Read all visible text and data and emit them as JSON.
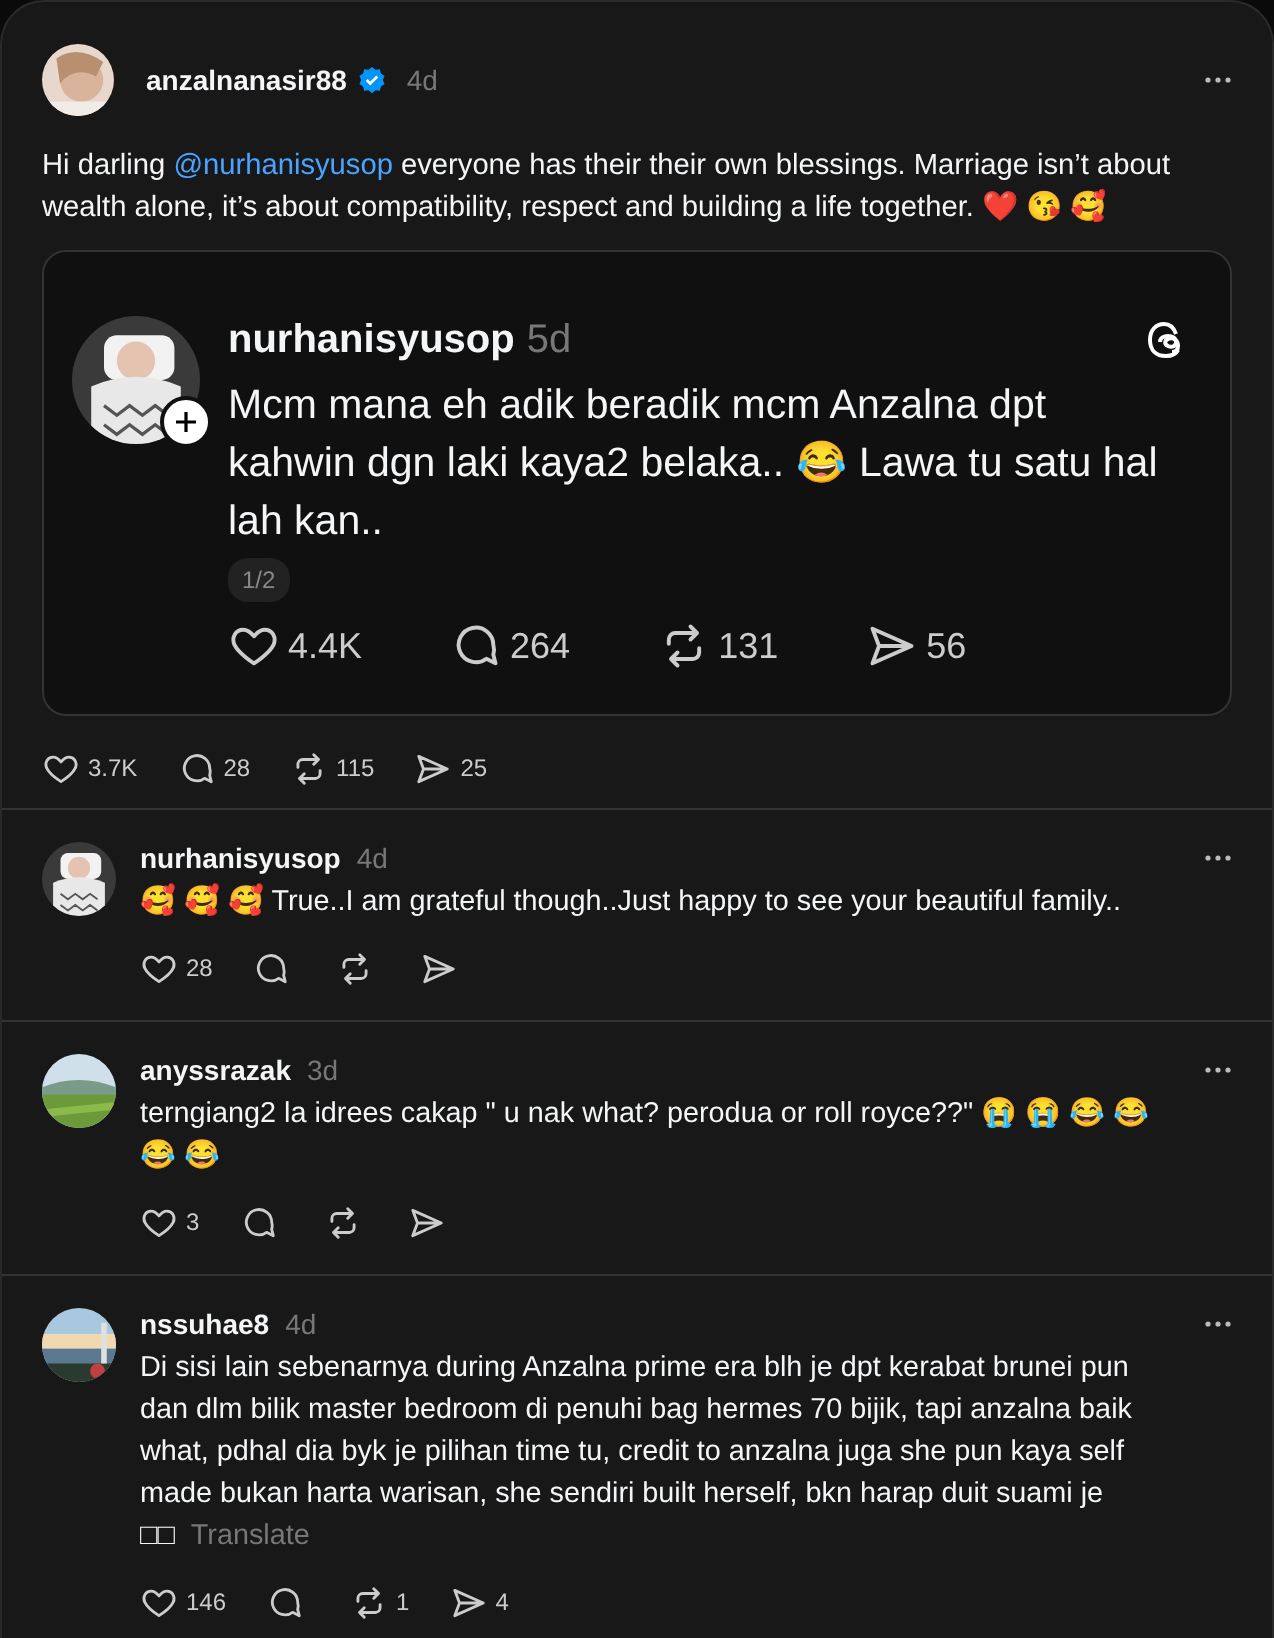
{
  "post": {
    "username": "anzalnanasir88",
    "verified": true,
    "time": "4d",
    "text": [
      {
        "kind": "text",
        "text": "Hi darling "
      },
      {
        "kind": "mention",
        "text": "@nurhanisyusop"
      },
      {
        "kind": "text",
        "text": " everyone has their their own blessings. Marriage isn’t about wealth alone, it’s about compatibility, respect and building a life together. ❤️ 😘 🥰"
      }
    ],
    "quote": {
      "username": "nurhanisyusop",
      "time": "5d",
      "text": "Mcm mana eh adik beradik mcm Anzalna dpt kahwin dgn laki kaya2 belaka.. 😂 Lawa tu satu hal lah kan..",
      "page": "1/2",
      "actions": [
        {
          "kind": "like",
          "count": "4.4K"
        },
        {
          "kind": "reply",
          "count": "264"
        },
        {
          "kind": "repost",
          "count": "131"
        },
        {
          "kind": "share",
          "count": "56"
        }
      ]
    },
    "actions": [
      {
        "kind": "like",
        "count": "3.7K"
      },
      {
        "kind": "reply",
        "count": "28"
      },
      {
        "kind": "repost",
        "count": "115"
      },
      {
        "kind": "share",
        "count": "25"
      }
    ]
  },
  "replies": [
    {
      "username": "nurhanisyusop",
      "time": "4d",
      "text": "🥰 🥰 🥰 True..I am grateful though..Just happy to see your beautiful family..",
      "actions": [
        {
          "kind": "like",
          "count": "28"
        },
        {
          "kind": "reply"
        },
        {
          "kind": "repost"
        },
        {
          "kind": "share"
        }
      ]
    },
    {
      "username": "anyssrazak",
      "time": "3d",
      "text": "terngiang2 la idrees cakap \" u nak what? perodua or roll royce??\" 😭 😭 😂 😂 😂 😂",
      "actions": [
        {
          "kind": "like",
          "count": "3"
        },
        {
          "kind": "reply"
        },
        {
          "kind": "repost"
        },
        {
          "kind": "share"
        }
      ]
    },
    {
      "username": "nssuhae8",
      "time": "4d",
      "text": "Di sisi lain sebenarnya during Anzalna prime era blh je dpt kerabat brunei pun dan dlm bilik master bedroom di penuhi bag hermes 70 bijik, tapi anzalna baik what, pdhal dia byk je pilihan time tu, credit to anzalna juga she pun kaya self made bukan harta warisan, she sendiri built herself, bkn harap duit suami je □□",
      "translate": "Translate",
      "actions": [
        {
          "kind": "like",
          "count": "146"
        },
        {
          "kind": "reply"
        },
        {
          "kind": "repost",
          "count": "1"
        },
        {
          "kind": "share",
          "count": "4"
        }
      ]
    }
  ]
}
